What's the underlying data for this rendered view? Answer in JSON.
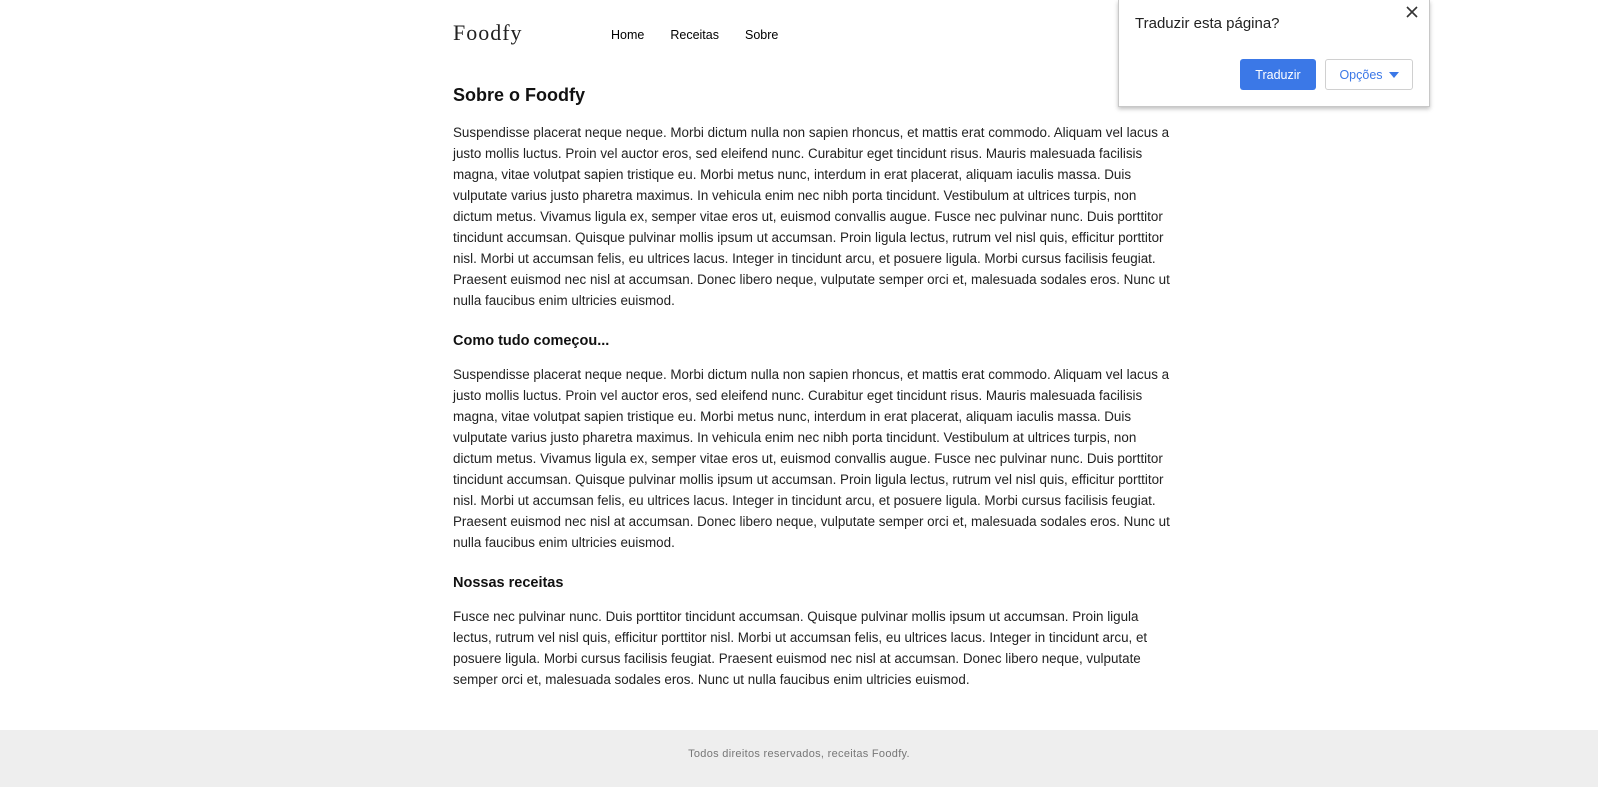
{
  "header": {
    "logo": "Foodfy",
    "nav": [
      {
        "label": "Home"
      },
      {
        "label": "Receitas"
      },
      {
        "label": "Sobre"
      }
    ]
  },
  "main": {
    "title": "Sobre o Foodfy",
    "intro": "Suspendisse placerat neque neque. Morbi dictum nulla non sapien rhoncus, et mattis erat commodo. Aliquam vel lacus a justo mollis luctus. Proin vel auctor eros, sed eleifend nunc. Curabitur eget tincidunt risus. Mauris malesuada facilisis magna, vitae volutpat sapien tristique eu. Morbi metus nunc, interdum in erat placerat, aliquam iaculis massa. Duis vulputate varius justo pharetra maximus. In vehicula enim nec nibh porta tincidunt. Vestibulum at ultrices turpis, non dictum metus. Vivamus ligula ex, semper vitae eros ut, euismod convallis augue. Fusce nec pulvinar nunc. Duis porttitor tincidunt accumsan. Quisque pulvinar mollis ipsum ut accumsan. Proin ligula lectus, rutrum vel nisl quis, efficitur porttitor nisl. Morbi ut accumsan felis, eu ultrices lacus. Integer in tincidunt arcu, et posuere ligula. Morbi cursus facilisis feugiat. Praesent euismod nec nisl at accumsan. Donec libero neque, vulputate semper orci et, malesuada sodales eros. Nunc ut nulla faucibus enim ultricies euismod.",
    "sections": [
      {
        "heading": "Como tudo começou...",
        "text": "Suspendisse placerat neque neque. Morbi dictum nulla non sapien rhoncus, et mattis erat commodo. Aliquam vel lacus a justo mollis luctus. Proin vel auctor eros, sed eleifend nunc. Curabitur eget tincidunt risus. Mauris malesuada facilisis magna, vitae volutpat sapien tristique eu. Morbi metus nunc, interdum in erat placerat, aliquam iaculis massa. Duis vulputate varius justo pharetra maximus. In vehicula enim nec nibh porta tincidunt. Vestibulum at ultrices turpis, non dictum metus. Vivamus ligula ex, semper vitae eros ut, euismod convallis augue. Fusce nec pulvinar nunc. Duis porttitor tincidunt accumsan. Quisque pulvinar mollis ipsum ut accumsan. Proin ligula lectus, rutrum vel nisl quis, efficitur porttitor nisl. Morbi ut accumsan felis, eu ultrices lacus. Integer in tincidunt arcu, et posuere ligula. Morbi cursus facilisis feugiat. Praesent euismod nec nisl at accumsan. Donec libero neque, vulputate semper orci et, malesuada sodales eros. Nunc ut nulla faucibus enim ultricies euismod."
      },
      {
        "heading": "Nossas receitas",
        "text": "Fusce nec pulvinar nunc. Duis porttitor tincidunt accumsan. Quisque pulvinar mollis ipsum ut accumsan. Proin ligula lectus, rutrum vel nisl quis, efficitur porttitor nisl. Morbi ut accumsan felis, eu ultrices lacus. Integer in tincidunt arcu, et posuere ligula. Morbi cursus facilisis feugiat. Praesent euismod nec nisl at accumsan. Donec libero neque, vulputate semper orci et, malesuada sodales eros. Nunc ut nulla faucibus enim ultricies euismod."
      }
    ]
  },
  "footer": {
    "text": "Todos direitos reservados, receitas Foodfy."
  },
  "translate_popup": {
    "title": "Traduzir esta página?",
    "close_icon": "close-icon",
    "translate_label": "Traduzir",
    "options_label": "Opções",
    "options_icon": "caret-down-icon",
    "accent_color": "#3b78e7"
  }
}
